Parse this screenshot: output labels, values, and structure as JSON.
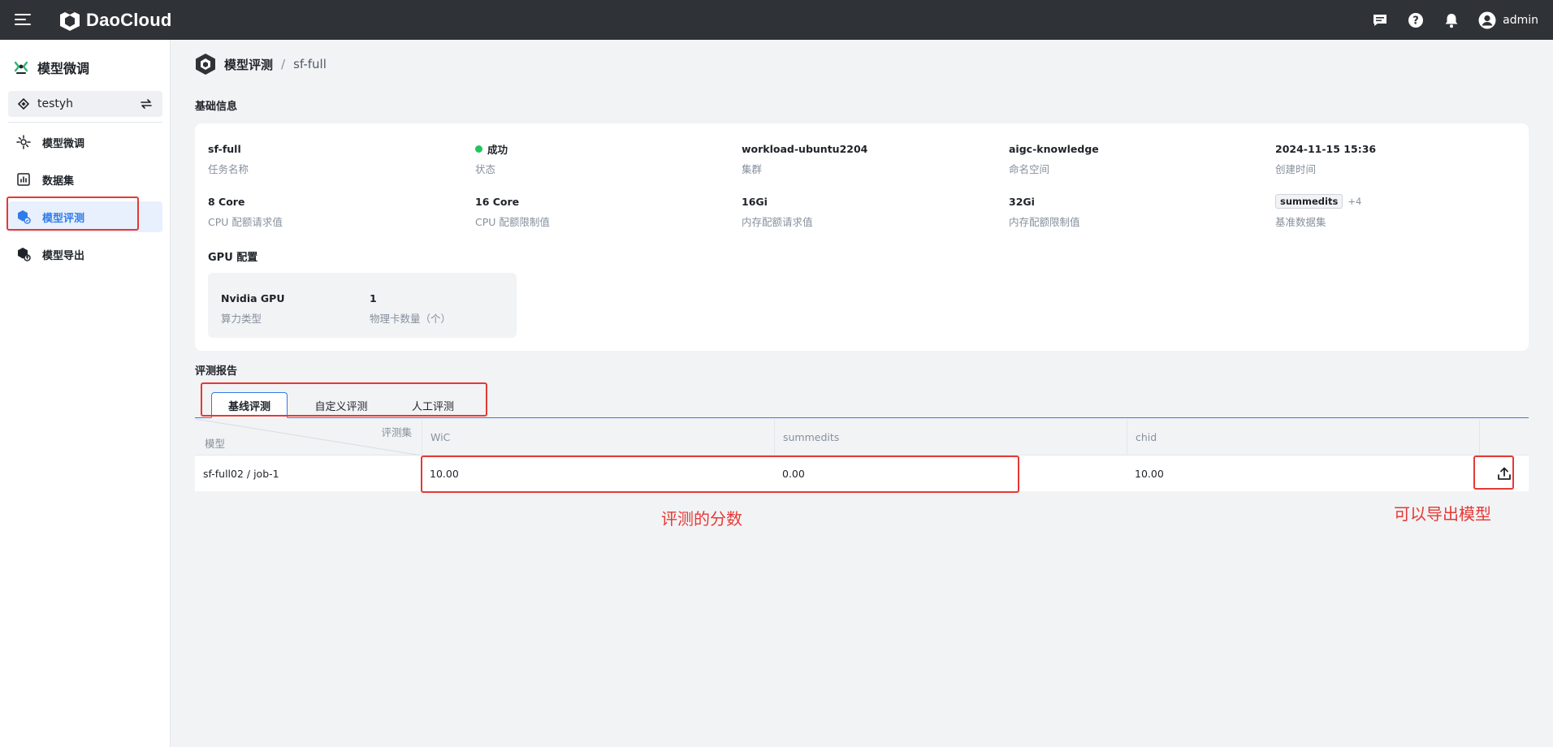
{
  "topbar": {
    "brand": "DaoCloud",
    "user": "admin"
  },
  "sidebar": {
    "title": "模型微调",
    "workspace": "testyh",
    "items": [
      {
        "label": "模型微调"
      },
      {
        "label": "数据集"
      },
      {
        "label": "模型评测"
      },
      {
        "label": "模型导出"
      }
    ]
  },
  "breadcrumb": {
    "parent": "模型评测",
    "separator": "/",
    "current": "sf-full"
  },
  "basic": {
    "section_title": "基础信息",
    "fields": [
      {
        "value": "sf-full",
        "label": "任务名称"
      },
      {
        "value": "成功",
        "label": "状态"
      },
      {
        "value": "workload-ubuntu2204",
        "label": "集群"
      },
      {
        "value": "aigc-knowledge",
        "label": "命名空间"
      },
      {
        "value": "2024-11-15 15:36",
        "label": "创建时间"
      },
      {
        "value": "8 Core",
        "label": "CPU 配额请求值"
      },
      {
        "value": "16 Core",
        "label": "CPU 配额限制值"
      },
      {
        "value": "16Gi",
        "label": "内存配额请求值"
      },
      {
        "value": "32Gi",
        "label": "内存配额限制值"
      },
      {
        "value": "summedits",
        "extra": "+4",
        "label": "基准数据集"
      }
    ],
    "status_color": "#22c55e",
    "gpu_title": "GPU 配置",
    "gpu": [
      {
        "value": "Nvidia GPU",
        "label": "算力类型"
      },
      {
        "value": "1",
        "label": "物理卡数量（个）"
      }
    ]
  },
  "report": {
    "section_title": "评测报告",
    "tabs": [
      {
        "label": "基线评测",
        "active": true
      },
      {
        "label": "自定义评测"
      },
      {
        "label": "人工评测"
      }
    ],
    "table": {
      "corner_top": "评测集",
      "corner_bottom": "模型",
      "columns": [
        "WiC",
        "summedits",
        "chid"
      ],
      "rows": [
        {
          "model": "sf-full02 / job-1",
          "scores": [
            "10.00",
            "0.00",
            "10.00"
          ]
        }
      ]
    }
  },
  "annotations": {
    "scores": "评测的分数",
    "export": "可以导出模型",
    "color": "#e53935"
  },
  "accent": "#2f7bea"
}
